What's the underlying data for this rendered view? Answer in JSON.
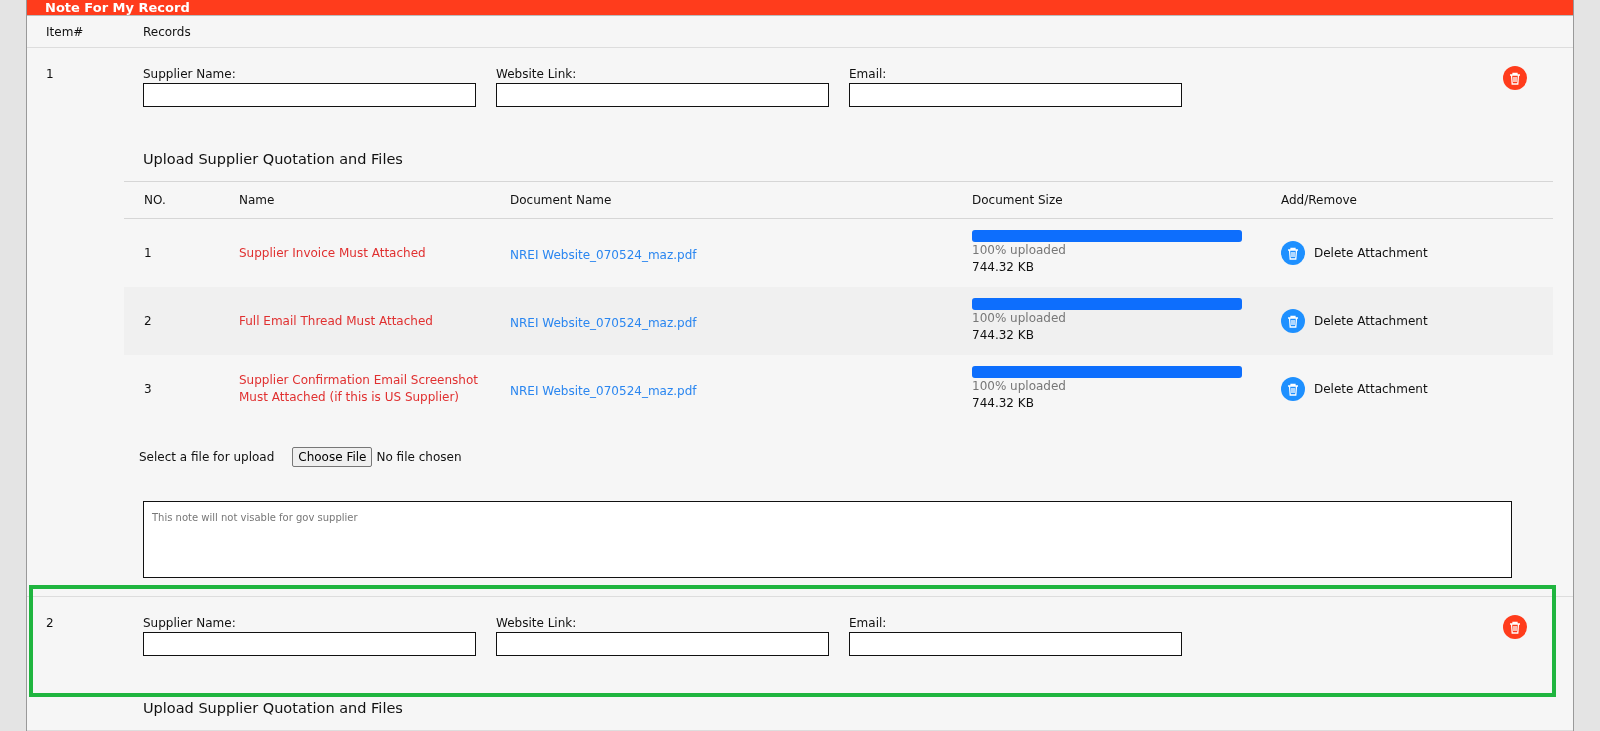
{
  "panel": {
    "title": "Note For My Record"
  },
  "columns": [
    "Item#",
    "Records"
  ],
  "records": [
    {
      "number": "1",
      "highlighted": false,
      "fields": [
        {
          "label": "Supplier Name:"
        },
        {
          "label": "Website Link:"
        },
        {
          "label": "Email:"
        }
      ],
      "upload_heading": "Upload Supplier Quotation and Files",
      "table": {
        "columns": [
          "NO.",
          "Name",
          "Document Name",
          "Document Size",
          "Add/Remove"
        ],
        "rows": [
          {
            "no": "1",
            "name": "Supplier Invoice Must Attached",
            "document": "NREI Website_070524_maz.pdf",
            "level": 1,
            "status": "100% uploaded",
            "size": "744.32 KB",
            "action": "Delete Attachment"
          },
          {
            "no": "2",
            "name": "Full Email Thread Must Attached",
            "document": "NREI Website_070524_maz.pdf",
            "level": 1,
            "status": "100% uploaded",
            "size": "744.32 KB",
            "action": "Delete Attachment"
          },
          {
            "no": "3",
            "name": "Supplier Confirmation Email Screenshot Must Attached (if this is US Supplier)",
            "document": "NREI Website_070524_maz.pdf",
            "level": 1,
            "status": "100% uploaded",
            "size": "744.32 KB",
            "action": "Delete Attachment"
          }
        ]
      },
      "file_picker": {
        "label": "Select a file for upload",
        "button": "Choose File",
        "status": "No file chosen"
      },
      "note": {
        "placeholder": "This note will not visable for gov supplier"
      }
    },
    {
      "number": "2",
      "highlighted": true,
      "fields": [
        {
          "label": "Supplier Name:"
        },
        {
          "label": "Website Link:"
        },
        {
          "label": "Email:"
        }
      ],
      "upload_heading": "Upload Supplier Quotation and Files"
    }
  ]
}
